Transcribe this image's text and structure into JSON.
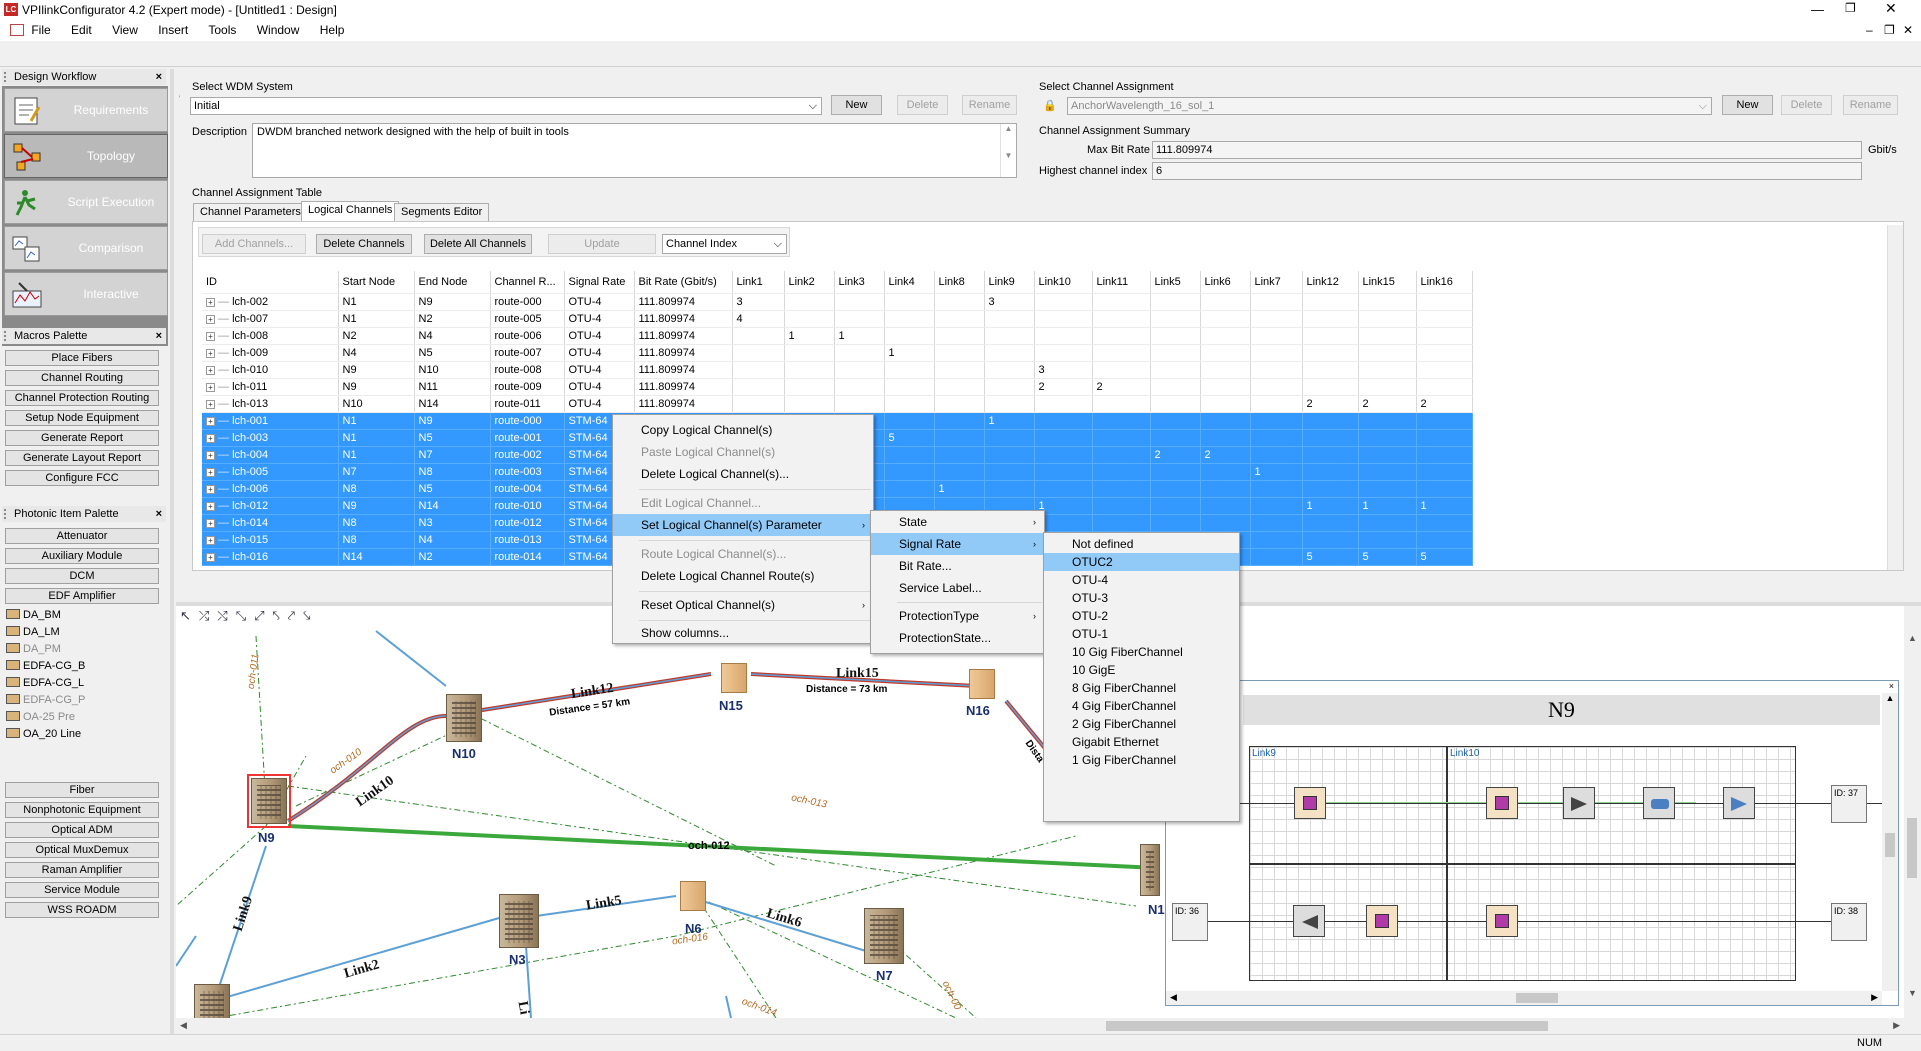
{
  "app": {
    "title": "VPIlinkConfigurator 4.2 (Expert mode) - [Untitled1 : Design]",
    "menu": [
      "File",
      "Edit",
      "View",
      "Insert",
      "Tools",
      "Window",
      "Help"
    ],
    "status": "NUM"
  },
  "workflow": {
    "title": "Design Workflow",
    "items": [
      "Requirements",
      "Topology",
      "Script Execution",
      "Comparison",
      "Interactive"
    ]
  },
  "macros": {
    "title": "Macros Palette",
    "items": [
      "Place Fibers",
      "Channel Routing",
      "Channel Protection Routing",
      "Setup Node Equipment",
      "Generate Report",
      "Generate Layout Report",
      "Configure FCC"
    ]
  },
  "photonic": {
    "title": "Photonic Item Palette",
    "top": [
      "Attenuator",
      "Auxiliary Module",
      "DCM",
      "EDF Amplifier"
    ],
    "amplifiers": [
      "DA_BM",
      "DA_LM",
      "DA_PM",
      "EDFA-CG_B",
      "EDFA-CG_L",
      "EDFA-CG_P",
      "OA-25 Pre",
      "OA_20 Line"
    ],
    "bottom": [
      "Fiber",
      "Nonphotonic Equipment",
      "Optical ADM",
      "Optical MuxDemux",
      "Raman Amplifier",
      "Service Module",
      "WSS ROADM"
    ]
  },
  "wdm": {
    "label": "Select WDM System",
    "value": "Initial",
    "new": "New",
    "delete": "Delete",
    "rename": "Rename",
    "desc_label": "Description",
    "description": "DWDM branched network designed with the help of built in tools"
  },
  "ca": {
    "label": "Select Channel Assignment",
    "value": "AnchorWavelength_16_sol_1",
    "new": "New",
    "delete": "Delete",
    "rename": "Rename",
    "summary": "Channel Assignment Summary",
    "max_label": "Max Bit Rate",
    "max_value": "111.809974",
    "unit": "Gbit/s",
    "hci_label": "Highest channel index",
    "hci_value": "6"
  },
  "table": {
    "title": "Channel Assignment Table",
    "tabs": [
      "Channel Parameters",
      "Logical Channels",
      "Segments Editor"
    ],
    "buttons": [
      "Add Channels...",
      "Delete Channels",
      "Delete All Channels",
      "Update"
    ],
    "sort": "Channel Index",
    "headers": [
      "ID",
      "Start Node",
      "End Node",
      "Channel R...",
      "Signal Rate",
      "Bit Rate (Gbit/s)",
      "Link1",
      "Link2",
      "Link3",
      "Link4",
      "Link8",
      "Link9",
      "Link10",
      "Link11",
      "Link5",
      "Link6",
      "Link7",
      "Link12",
      "Link15",
      "Link16"
    ],
    "rows": [
      [
        "lch-002",
        "N1",
        "N9",
        "route-000",
        "OTU-4",
        "111.809974",
        "3",
        "",
        "",
        "",
        "",
        "3",
        "",
        "",
        "",
        "",
        "",
        "",
        "",
        ""
      ],
      [
        "lch-007",
        "N1",
        "N2",
        "route-005",
        "OTU-4",
        "111.809974",
        "4",
        "",
        "",
        "",
        "",
        "",
        "",
        "",
        "",
        "",
        "",
        "",
        "",
        ""
      ],
      [
        "lch-008",
        "N2",
        "N4",
        "route-006",
        "OTU-4",
        "111.809974",
        "",
        "1",
        "1",
        "",
        "",
        "",
        "",
        "",
        "",
        "",
        "",
        "",
        "",
        ""
      ],
      [
        "lch-009",
        "N4",
        "N5",
        "route-007",
        "OTU-4",
        "111.809974",
        "",
        "",
        "",
        "1",
        "",
        "",
        "",
        "",
        "",
        "",
        "",
        "",
        "",
        ""
      ],
      [
        "lch-010",
        "N9",
        "N10",
        "route-008",
        "OTU-4",
        "111.809974",
        "",
        "",
        "",
        "",
        "",
        "",
        "3",
        "",
        "",
        "",
        "",
        "",
        "",
        ""
      ],
      [
        "lch-011",
        "N9",
        "N11",
        "route-009",
        "OTU-4",
        "111.809974",
        "",
        "",
        "",
        "",
        "",
        "",
        "2",
        "2",
        "",
        "",
        "",
        "",
        "",
        ""
      ],
      [
        "lch-013",
        "N10",
        "N14",
        "route-011",
        "OTU-4",
        "111.809974",
        "",
        "",
        "",
        "",
        "",
        "",
        "",
        "",
        "",
        "",
        "",
        "2",
        "2",
        "2"
      ],
      [
        "lch-001",
        "N1",
        "N9",
        "route-000",
        "STM-64",
        "",
        "",
        "",
        "",
        "",
        "",
        "1",
        "",
        "",
        "",
        "",
        "",
        "",
        "",
        ""
      ],
      [
        "lch-003",
        "N1",
        "N5",
        "route-001",
        "STM-64",
        "",
        "",
        "",
        "",
        "5",
        "",
        "",
        "",
        "",
        "",
        "",
        "",
        "",
        "",
        ""
      ],
      [
        "lch-004",
        "N1",
        "N7",
        "route-002",
        "STM-64",
        "",
        "",
        "",
        "",
        "",
        "",
        "",
        "",
        "",
        "2",
        "2",
        "",
        "",
        "",
        ""
      ],
      [
        "lch-005",
        "N7",
        "N8",
        "route-003",
        "STM-64",
        "",
        "",
        "",
        "",
        "",
        "",
        "",
        "",
        "",
        "",
        "",
        "1",
        "",
        "",
        ""
      ],
      [
        "lch-006",
        "N8",
        "N5",
        "route-004",
        "STM-64",
        "",
        "",
        "",
        "",
        "",
        "1",
        "",
        "",
        "",
        "",
        "",
        "",
        "",
        "",
        ""
      ],
      [
        "lch-012",
        "N9",
        "N14",
        "route-010",
        "STM-64",
        "",
        "",
        "",
        "",
        "",
        "",
        "",
        "1",
        "",
        "",
        "",
        "",
        "1",
        "1",
        "1"
      ],
      [
        "lch-014",
        "N8",
        "N3",
        "route-012",
        "STM-64",
        "",
        "",
        "",
        "",
        "",
        "",
        "",
        "",
        "",
        "",
        "",
        "",
        "",
        "",
        ""
      ],
      [
        "lch-015",
        "N8",
        "N4",
        "route-013",
        "STM-64",
        "",
        "",
        "",
        "",
        "",
        "",
        "",
        "",
        "",
        "",
        "",
        "",
        "",
        "",
        ""
      ],
      [
        "lch-016",
        "N14",
        "N2",
        "route-014",
        "STM-64",
        "",
        "",
        "",
        "",
        "",
        "",
        "",
        "",
        "",
        "",
        "",
        "",
        "5",
        "5",
        "5"
      ]
    ]
  },
  "ctx": {
    "items": [
      "Copy Logical Channel(s)",
      "Paste Logical Channel(s)",
      "Delete Logical Channel(s)...",
      "Edit Logical Channel...",
      "Set Logical Channel(s) Parameter",
      "Route Logical Channel(s)...",
      "Delete Logical Channel Route(s)",
      "Reset Optical Channel(s)",
      "Show columns..."
    ]
  },
  "sub1": {
    "items": [
      "State",
      "Signal Rate",
      "Bit Rate...",
      "Service Label...",
      "ProtectionType",
      "ProtectionState..."
    ]
  },
  "sub2": {
    "items": [
      "Not defined",
      "OTUC2",
      "OTU-4",
      "OTU-3",
      "OTU-2",
      "OTU-1",
      "10 Gig FiberChannel",
      "10 GigE",
      "8 Gig FiberChannel",
      "4 Gig FiberChannel",
      "2 Gig FiberChannel",
      "Gigabit Ethernet",
      "1 Gig FiberChannel"
    ]
  },
  "topology": {
    "nodes": [
      "N9",
      "N10",
      "N15",
      "N16",
      "N3",
      "N6",
      "N7",
      "N1"
    ],
    "links": [
      "Link12",
      "Link15",
      "Link10",
      "Link9",
      "Link5",
      "Link6",
      "Link2",
      "Li"
    ],
    "distances": [
      "Distance = 57 km",
      "Distance = 73 km",
      "Dista"
    ],
    "och": [
      "och-011",
      "och-010",
      "och-013",
      "och-012",
      "och-016",
      "och-014",
      "och-00"
    ]
  },
  "n9": {
    "title": "N9",
    "link9": "Link9",
    "link10": "Link10",
    "ids": [
      "ID: 37",
      "ID: 36",
      "ID: 38"
    ]
  }
}
